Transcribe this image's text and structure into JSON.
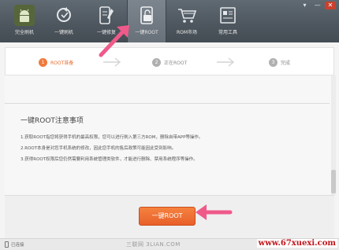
{
  "toolbar": {
    "buttons": [
      {
        "label": "完全刷机",
        "icon": "android-logo-icon"
      },
      {
        "label": "一键刷机",
        "icon": "refresh-icon"
      },
      {
        "label": "一键修复",
        "icon": "repair-icon"
      },
      {
        "label": "一键ROOT",
        "icon": "lock-icon",
        "active": true
      },
      {
        "label": "ROM市场",
        "icon": "cart-icon"
      },
      {
        "label": "常用工具",
        "icon": "tools-icon"
      }
    ],
    "window_controls": {
      "menu": "▾",
      "minimize": "—",
      "close": "✕"
    }
  },
  "steps": [
    {
      "num": "1",
      "label": "ROOT准备",
      "current": true
    },
    {
      "num": "2",
      "label": "正在ROOT",
      "current": false
    },
    {
      "num": "3",
      "label": "完成",
      "current": false
    }
  ],
  "notice": {
    "title": "一键ROOT注意事项",
    "items": [
      "1.获取ROOT指您将获得手机的最高权限，您可以进行刷入第三方ROM，删除自带APP等操作。",
      "2.ROOT本身是对您手机系统的修改，因此您手机的售后政策可能因此受到影响。",
      "3.获得ROOT权限后您仍然需要利用系统管理类软件，才能进行删除、禁用系统程序等操作。"
    ]
  },
  "action": {
    "root_button": "一键ROOT"
  },
  "statusbar": {
    "device_status": "已连接",
    "watermark": "三联网 3LIAN.COM",
    "site": "www.67xuexi.com"
  },
  "colors": {
    "accent": "#ef7a3d",
    "toolbar": "#4d565e",
    "pointer": "#ef5a8a"
  }
}
